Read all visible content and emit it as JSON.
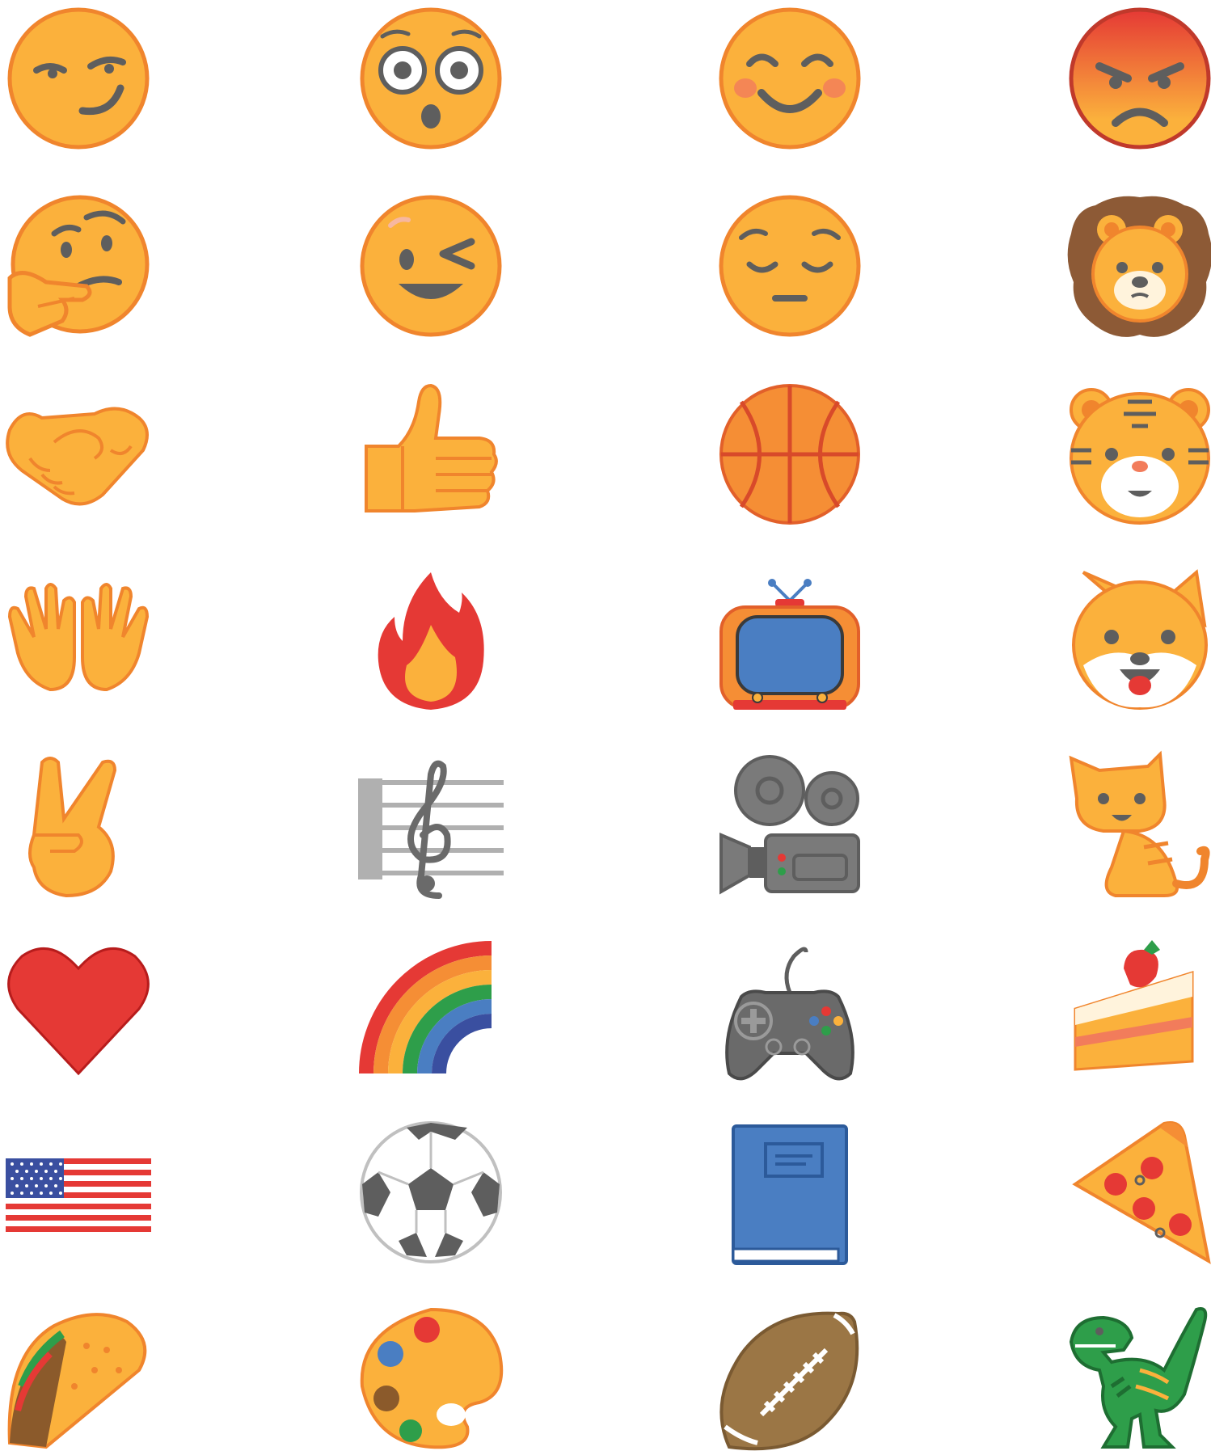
{
  "title": "",
  "colors": {
    "face": "#FBB13C",
    "face_outline": "#F0852D",
    "feature": "#5E5E5E",
    "red": "#E53935",
    "blue": "#4A7EC2",
    "green": "#2E9E4A",
    "gray": "#707070",
    "brown": "#8B5A2B"
  },
  "emojis": [
    {
      "name": "smirking-face-icon"
    },
    {
      "name": "flushed-face-icon"
    },
    {
      "name": "smiling-face-icon"
    },
    {
      "name": "angry-face-icon"
    },
    {
      "name": "thinking-face-icon"
    },
    {
      "name": "winking-face-icon"
    },
    {
      "name": "pensive-face-icon"
    },
    {
      "name": "lion-face-icon"
    },
    {
      "name": "handshake-icon"
    },
    {
      "name": "thumbs-up-icon"
    },
    {
      "name": "basketball-icon"
    },
    {
      "name": "tiger-face-icon"
    },
    {
      "name": "open-hands-icon"
    },
    {
      "name": "fire-icon"
    },
    {
      "name": "television-icon"
    },
    {
      "name": "dog-face-icon"
    },
    {
      "name": "victory-hand-icon"
    },
    {
      "name": "musical-score-icon"
    },
    {
      "name": "movie-camera-icon"
    },
    {
      "name": "tiger-cat-icon"
    },
    {
      "name": "red-heart-icon"
    },
    {
      "name": "rainbow-icon"
    },
    {
      "name": "video-game-controller-icon"
    },
    {
      "name": "shortcake-icon"
    },
    {
      "name": "us-flag-icon"
    },
    {
      "name": "soccer-ball-icon"
    },
    {
      "name": "blue-book-icon"
    },
    {
      "name": "pizza-slice-icon"
    },
    {
      "name": "taco-icon"
    },
    {
      "name": "artist-palette-icon"
    },
    {
      "name": "american-football-icon"
    },
    {
      "name": "t-rex-icon"
    }
  ]
}
